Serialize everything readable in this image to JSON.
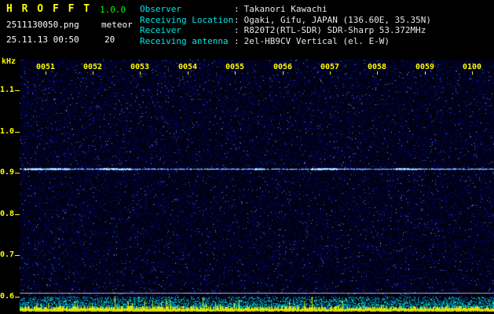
{
  "header": {
    "app_title": "H R O F F T",
    "version": "1.0.0",
    "filename": "2511130050.png",
    "mode": "meteor",
    "datetime": "25.11.13 00:50",
    "count": "20",
    "separator": ":",
    "info_rows": [
      {
        "label": "Observer",
        "value": "Takanori Kawachi"
      },
      {
        "label": "Receiving Location",
        "value": "Ogaki, Gifu, JAPAN (136.60E, 35.35N)"
      },
      {
        "label": "Receiver",
        "value": "R820T2(RTL-SDR) SDR-Sharp 53.372MHz"
      },
      {
        "label": "Receiving antenna",
        "value": "2el-HB9CV Vertical (el. E-W)"
      }
    ]
  },
  "axes": {
    "y_unit": "kHz",
    "freq_ticks": [
      "1.1",
      "1.0",
      "0.9",
      "0.8",
      "0.7",
      "0.6"
    ],
    "time_ticks": [
      "0051",
      "0052",
      "0053",
      "0054",
      "0055",
      "0056",
      "0057",
      "0058",
      "0059",
      "0100"
    ]
  },
  "colors": {
    "title_yellow": "#ffff00",
    "version_green": "#00ff00",
    "label_cyan": "#00e8e8",
    "value_white": "#e8e8e8",
    "axis_yellow": "#ffff00",
    "noise_blue": "#2233cc",
    "carrier_cyan": "#bfefff",
    "reference_gray": "#b8b8c0",
    "strip_cyan": "#00cfee",
    "strip_yellow": "#ffff00"
  },
  "chart_data": {
    "type": "heatmap",
    "title": "HROFFT radio meteor echo spectrogram (10-minute waterfall)",
    "x": {
      "tick_labels": [
        "0051",
        "0052",
        "0053",
        "0054",
        "0055",
        "0056",
        "0057",
        "0058",
        "0059",
        "0100"
      ],
      "start": "00:51",
      "end": "01:00",
      "minutes_per_division": 1
    },
    "y": {
      "unit": "kHz",
      "tick_labels": [
        1.1,
        1.0,
        0.9,
        0.8,
        0.7,
        0.6
      ],
      "range": [
        1.17,
        0.58
      ]
    },
    "features": {
      "carrier_line_khz": 0.91,
      "reference_line_khz": 0.61,
      "background": "uniform dark-blue random noise floor",
      "carrier": "continuous bright cyan-white direct carrier trace at ~0.91 kHz with brighter meteor-echo segments",
      "bottom_strip": "signal-level oscillogram: dense cyan noise with yellow peak spikes along baseline"
    }
  }
}
